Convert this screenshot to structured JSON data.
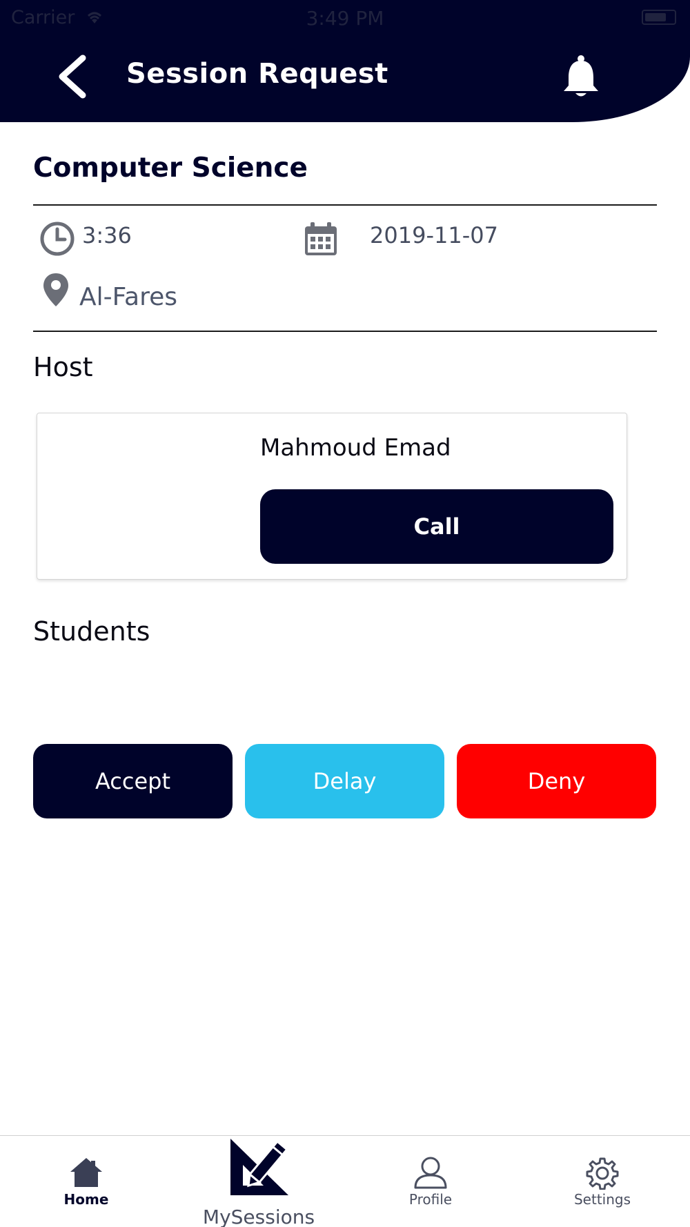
{
  "status_bar": {
    "carrier": "Carrier",
    "time": "3:49 PM"
  },
  "header": {
    "title": "Session Request"
  },
  "session": {
    "subject": "Computer Science",
    "time": "3:36",
    "date": "2019-11-07",
    "location": "Al-Fares"
  },
  "host": {
    "section_label": "Host",
    "name": "Mahmoud Emad",
    "call_label": "Call"
  },
  "students": {
    "section_label": "Students"
  },
  "actions": {
    "accept_label": "Accept",
    "delay_label": "Delay",
    "deny_label": "Deny"
  },
  "tabbar": {
    "home_label": "Home",
    "sessions_label": "MySessions",
    "profile_label": "Profile",
    "settings_label": "Settings"
  },
  "colors": {
    "primary": "#00032a",
    "delay": "#29c0ec",
    "deny": "#ff0000"
  },
  "icons": [
    "back-icon",
    "bell-icon",
    "clock-icon",
    "calendar-icon",
    "location-icon",
    "home-icon",
    "sessions-icon",
    "profile-icon",
    "settings-icon"
  ]
}
